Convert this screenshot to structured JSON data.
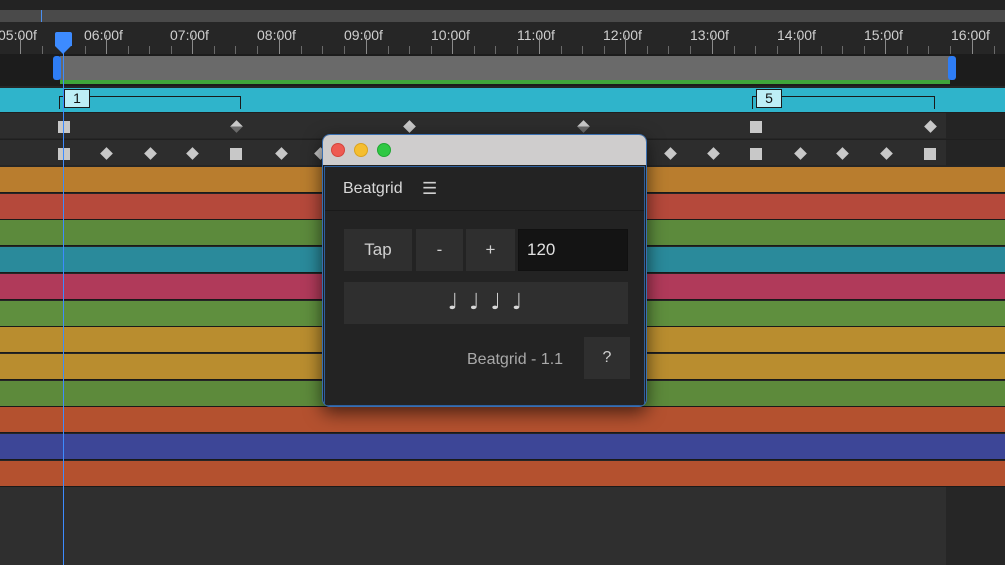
{
  "timeline": {
    "ruler_labels": [
      "05:00f",
      "06:00f",
      "07:00f",
      "08:00f",
      "09:00f",
      "10:00f",
      "11:00f",
      "12:00f",
      "13:00f",
      "14:00f",
      "15:00f",
      "16:00f"
    ],
    "markers": [
      {
        "label": "1"
      },
      {
        "label": "5"
      }
    ],
    "layer_colors": [
      "#b97d2e",
      "#b5493b",
      "#5c8a3c",
      "#2a8a9b",
      "#b03a5a",
      "#5f8f3e",
      "#b98d2f",
      "#b98d2f",
      "#5d8a3b",
      "#b4512f",
      "#3d4697",
      "#b4512f"
    ],
    "audio_layer_color": "#2fb4cb",
    "playhead_color": "#3d8bff"
  },
  "beatgrid": {
    "title": "Beatgrid",
    "menu_icon": "hamburger-menu-icon",
    "tap_label": "Tap",
    "minus_label": "-",
    "plus_label": "+",
    "bpm_value": "120",
    "notes": "♩ ♩ ♩ ♩",
    "version": "Beatgrid - 1.1",
    "help_label": "?"
  }
}
